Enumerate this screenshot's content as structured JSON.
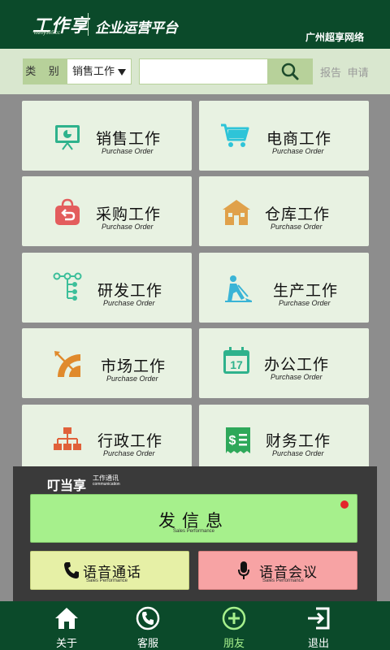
{
  "header": {
    "logo": "工作享",
    "logo_sub": "tozoy365.cc",
    "platform": "企业运营平台",
    "company": "广州超享网络"
  },
  "search": {
    "category_label": "类 别",
    "category_value": "销售工作",
    "placeholder": "",
    "links": [
      "报告",
      "申请"
    ]
  },
  "cards": [
    {
      "title": "销售工作",
      "subtitle": "Purchase Order",
      "icon": "presentation-board-icon",
      "color": "#2eb28c"
    },
    {
      "title": "电商工作",
      "subtitle": "Purchase Order",
      "icon": "shopping-cart-icon",
      "color": "#2ec4d8"
    },
    {
      "title": "采购工作",
      "subtitle": "Purchase Order",
      "icon": "shopping-bag-icon",
      "color": "#e35d5d"
    },
    {
      "title": "仓库工作",
      "subtitle": "Purchase Order",
      "icon": "warehouse-icon",
      "color": "#e0a14a"
    },
    {
      "title": "研发工作",
      "subtitle": "Purchase Order",
      "icon": "tree-structure-icon",
      "color": "#3cbf9a"
    },
    {
      "title": "生产工作",
      "subtitle": "Purchase Order",
      "icon": "worker-shovel-icon",
      "color": "#3ab4d6"
    },
    {
      "title": "市场工作",
      "subtitle": "Purchase Order",
      "icon": "target-arrow-icon",
      "color": "#e08a2c"
    },
    {
      "title": "办公工作",
      "subtitle": "Purchase Order",
      "icon": "calendar-icon",
      "color": "#2eb28c",
      "day": "17"
    },
    {
      "title": "行政工作",
      "subtitle": "Purchase Order",
      "icon": "org-chart-icon",
      "color": "#e0613a"
    },
    {
      "title": "财务工作",
      "subtitle": "Purchase Order",
      "icon": "receipt-icon",
      "color": "#2ea85a"
    }
  ],
  "comm": {
    "title": "叮当享",
    "tag_line1": "工作通讯",
    "tag_line2": "communication",
    "send_label": "发信息",
    "send_sub": "Sales Performance",
    "voice_label": "语音通话",
    "voice_sub": "Sales Performance",
    "meeting_label": "语音会议",
    "meeting_sub": "Sales Performance"
  },
  "tabs": [
    {
      "label": "关于",
      "icon": "house-icon"
    },
    {
      "label": "客服",
      "icon": "phone-circle-icon"
    },
    {
      "label": "朋友",
      "icon": "plus-circle-icon",
      "active": true
    },
    {
      "label": "退出",
      "icon": "exit-door-icon"
    }
  ],
  "colors": {
    "brand": "#0b4a2a",
    "accent_green": "#a6f08c",
    "yellow": "#e6f0a6",
    "pink": "#f7a3a4",
    "alert": "#e3262b"
  }
}
